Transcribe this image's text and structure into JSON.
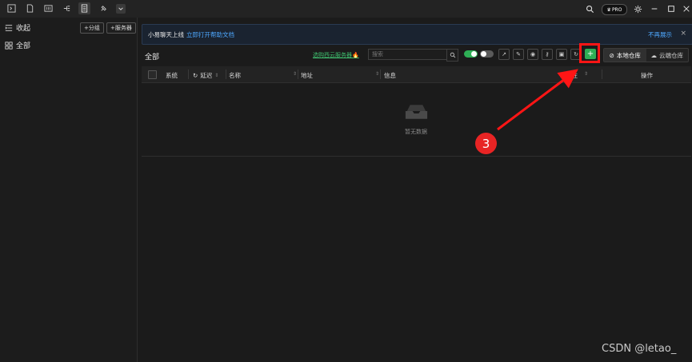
{
  "titlebar": {
    "pro_label": "PRO",
    "icons": [
      "terminal-icon",
      "file-icon",
      "sftp-icon",
      "split-icon",
      "list-icon",
      "pin-icon",
      "chevron-down-icon"
    ],
    "window_icons": [
      "search-icon",
      "pro-badge",
      "settings-icon",
      "minimize-icon",
      "maximize-icon",
      "close-icon"
    ]
  },
  "sidebar": {
    "collapse_label": "收起",
    "add_group_label": "+分组",
    "add_server_label": "+服务器",
    "all_label": "全部"
  },
  "notice": {
    "text": "小易聊天上线",
    "link": "立即打开帮助文档",
    "dismiss": "不再展示",
    "close": "×"
  },
  "main": {
    "title": "全部",
    "promo": "选购西云服务器",
    "search_placeholder": "搜索",
    "add_button": "+",
    "local_repo": "本地仓库",
    "cloud_repo": "云端仓库",
    "toggles": [
      true,
      false
    ]
  },
  "table": {
    "headers": {
      "system": "系统",
      "latency": "延迟",
      "name": "名称",
      "address": "地址",
      "info": "信息",
      "remark": "备注",
      "actions": "操作"
    },
    "empty_text": "暂无数据"
  },
  "annotation": {
    "step_number": "3",
    "color": "#ff1515"
  },
  "watermark": "CSDN @letao_",
  "colors": {
    "accent_green": "#2eae55",
    "link_blue": "#4ea8ff",
    "annotation_red": "#ff1515"
  }
}
